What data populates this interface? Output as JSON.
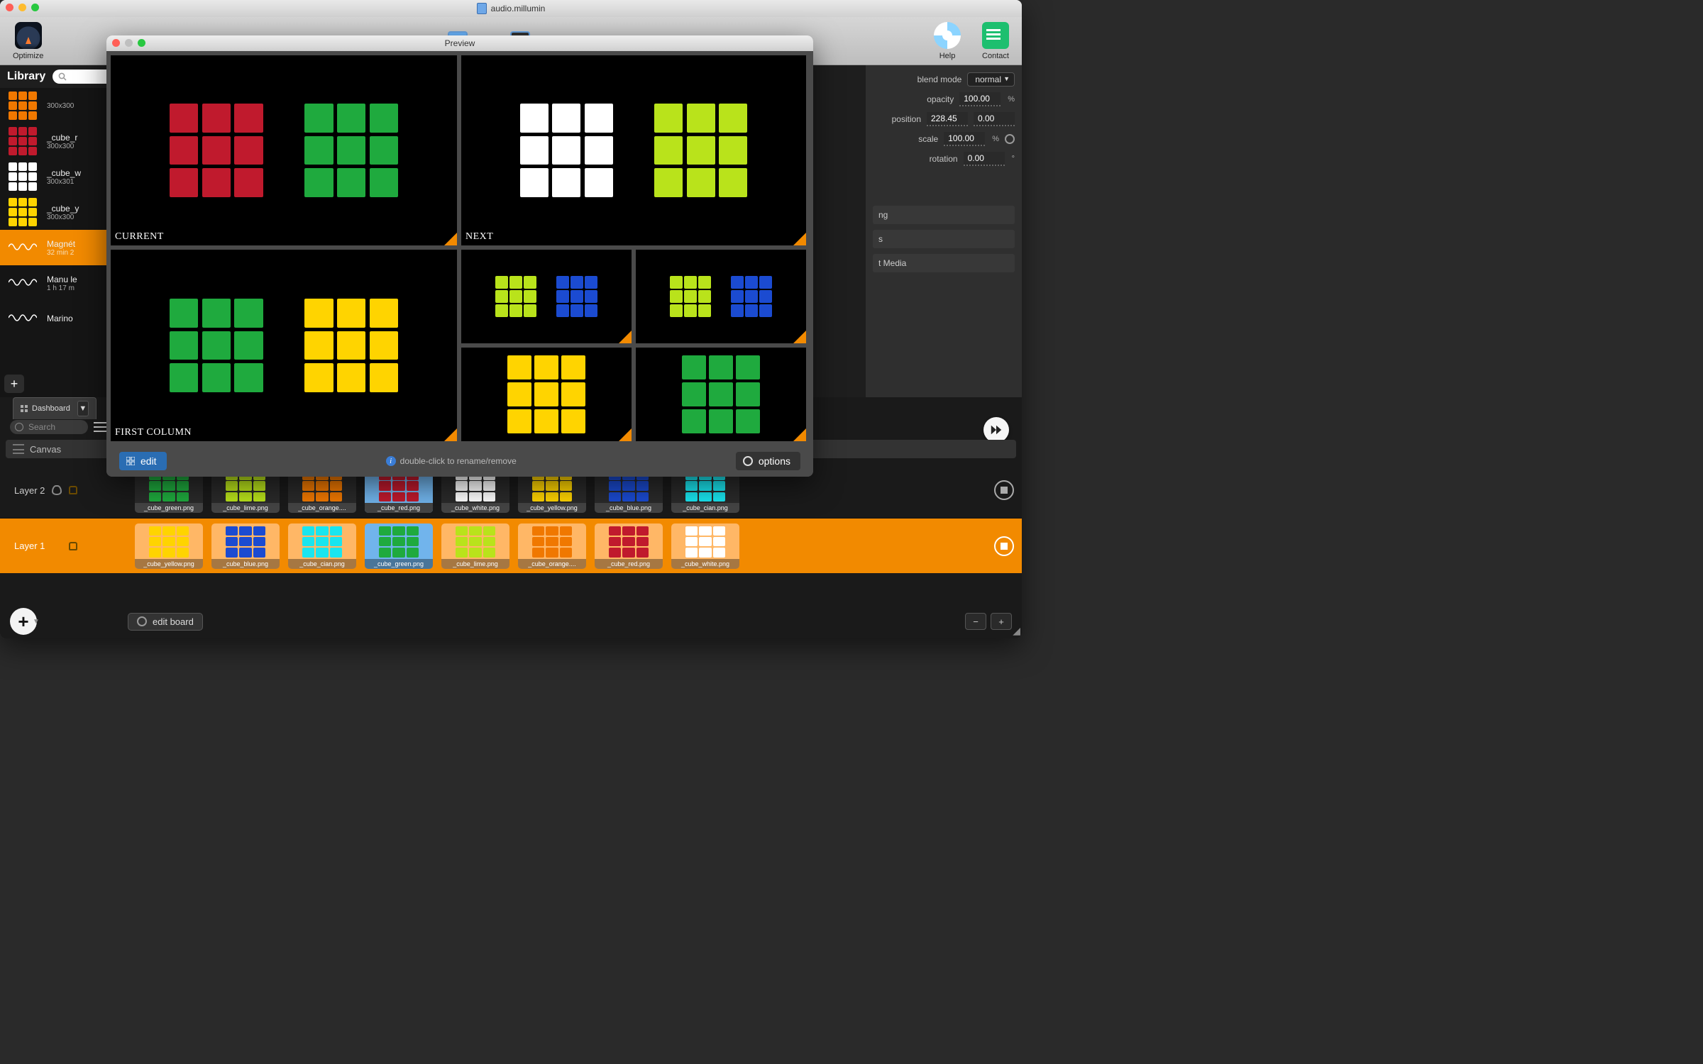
{
  "window_title": "audio.millumin",
  "toolbar": {
    "optimize": "Optimize",
    "help": "Help",
    "contact": "Contact"
  },
  "library": {
    "title": "Library",
    "search_placeholder": "",
    "items": [
      {
        "name": "",
        "sub": "300x300",
        "cube": "#f07800"
      },
      {
        "name": "_cube_r",
        "sub": "300x300",
        "cube": "#c01a2d"
      },
      {
        "name": "_cube_w",
        "sub": "300x301",
        "cube": "#ffffff"
      },
      {
        "name": "_cube_y",
        "sub": "300x300",
        "cube": "#ffd400"
      },
      {
        "name": "Magnét",
        "sub": "32 min 2",
        "wave": true,
        "selected": true
      },
      {
        "name": "Manu le",
        "sub": "1 h  17 m",
        "wave": true
      },
      {
        "name": "Marino",
        "sub": "",
        "wave": true
      }
    ]
  },
  "properties": {
    "blend_mode_label": "blend mode",
    "blend_mode_value": "normal",
    "opacity_label": "opacity",
    "opacity_value": "100.00",
    "position_label": "position",
    "position_x": "228.45",
    "position_y": "0.00",
    "scale_label": "scale",
    "scale_value": "100.00",
    "rotation_label": "rotation",
    "rotation_value": "0.00",
    "percent": "%",
    "degree": "°",
    "sections": [
      {
        "label": "ng"
      },
      {
        "label": "s"
      },
      {
        "label": "t Media"
      }
    ]
  },
  "bottom": {
    "dashboard_tab": "Dashboard",
    "search_placeholder": "Search",
    "canvas_label": "Canvas",
    "layers": [
      {
        "name": "Layer 2",
        "selected": false,
        "clips": [
          {
            "label": "_cube_green.png",
            "color": "#1faa3e",
            "active": false
          },
          {
            "label": "_cube_lime.png",
            "color": "#b9e31b",
            "active": false
          },
          {
            "label": "_cube_orange....",
            "color": "#f07800",
            "active": false
          },
          {
            "label": "_cube_red.png",
            "color": "#c01a2d",
            "active": true
          },
          {
            "label": "_cube_white.png",
            "color": "#ffffff",
            "active": false
          },
          {
            "label": "_cube_yellow.png",
            "color": "#ffd400",
            "active": false
          },
          {
            "label": "_cube_blue.png",
            "color": "#1b4bd1",
            "active": false
          },
          {
            "label": "_cube_cian.png",
            "color": "#19e5ef",
            "active": false
          }
        ]
      },
      {
        "name": "Layer 1",
        "selected": true,
        "clips": [
          {
            "label": "_cube_yellow.png",
            "color": "#ffd400",
            "active": false
          },
          {
            "label": "_cube_blue.png",
            "color": "#1b4bd1",
            "active": false
          },
          {
            "label": "_cube_cian.png",
            "color": "#19e5ef",
            "active": false
          },
          {
            "label": "_cube_green.png",
            "color": "#1faa3e",
            "active": true
          },
          {
            "label": "_cube_lime.png",
            "color": "#b9e31b",
            "active": false
          },
          {
            "label": "_cube_orange....",
            "color": "#f07800",
            "active": false
          },
          {
            "label": "_cube_red.png",
            "color": "#c01a2d",
            "active": false
          },
          {
            "label": "_cube_white.png",
            "color": "#ffffff",
            "active": false
          }
        ]
      }
    ],
    "edit_board": "edit board"
  },
  "preview": {
    "title": "Preview",
    "labels": {
      "current": "CURRENT",
      "next": "NEXT",
      "first_column": "FIRST COLUMN"
    },
    "hint": "double-click to rename/remove",
    "edit_label": "edit",
    "options_label": "options",
    "cells": {
      "a": [
        "#c01a2d",
        "#1faa3e"
      ],
      "b": [
        "#ffffff",
        "#b9e31b"
      ],
      "c": [
        "#1faa3e",
        "#ffd400"
      ],
      "d": [
        "#b9e31b",
        "#1b4bd1"
      ],
      "e": [
        "#b9e31b",
        "#1b4bd1"
      ],
      "f": [
        "#ffd400"
      ],
      "g": [
        "#1faa3e"
      ]
    }
  }
}
